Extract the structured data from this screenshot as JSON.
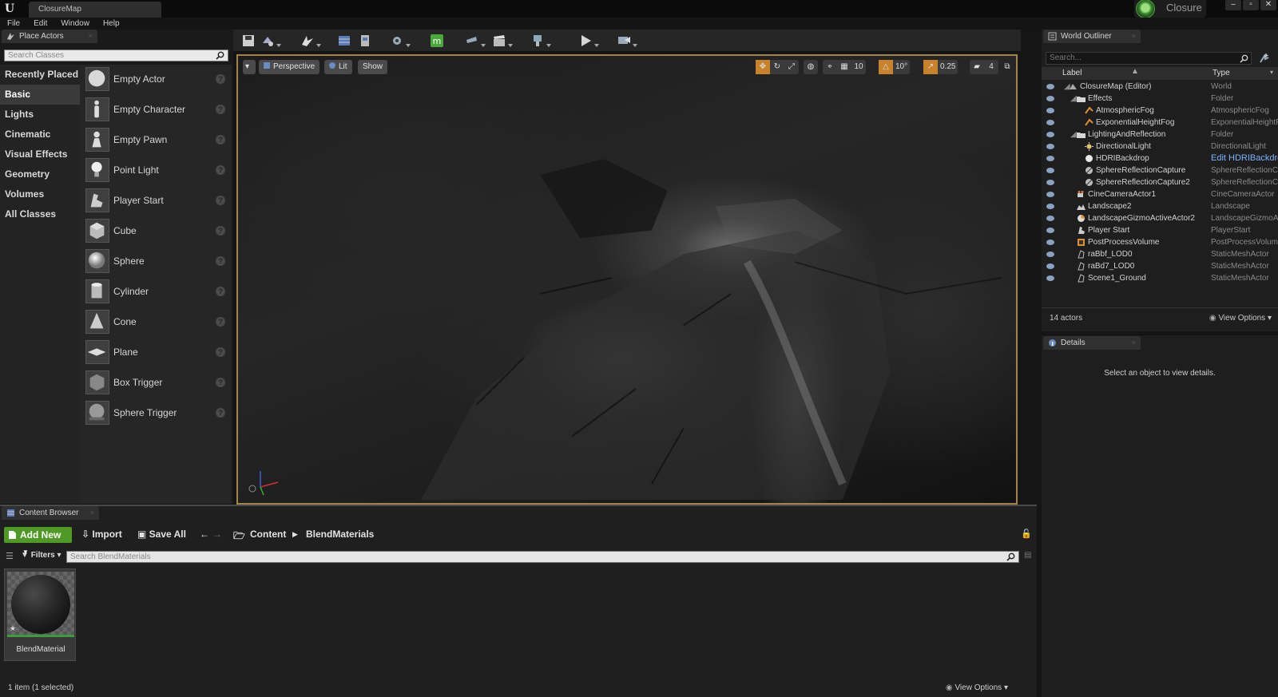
{
  "window": {
    "doc_tab": "ClosureMap",
    "project_name": "Closure",
    "controls": [
      "–",
      "▫",
      "✕"
    ]
  },
  "menu": [
    "File",
    "Edit",
    "Window",
    "Help"
  ],
  "place_actors": {
    "tab_label": "Place Actors",
    "search_placeholder": "Search Classes",
    "categories": [
      "Recently Placed",
      "Basic",
      "Lights",
      "Cinematic",
      "Visual Effects",
      "Geometry",
      "Volumes",
      "All Classes"
    ],
    "active_category": "Basic",
    "items": [
      "Empty Actor",
      "Empty Character",
      "Empty Pawn",
      "Point Light",
      "Player Start",
      "Cube",
      "Sphere",
      "Cylinder",
      "Cone",
      "Plane",
      "Box Trigger",
      "Sphere Trigger"
    ]
  },
  "viewport": {
    "perspective_label": "Perspective",
    "lit_label": "Lit",
    "show_label": "Show",
    "grid_snap": "10",
    "rotation_snap": "10°",
    "scale_snap": "0.25",
    "camera_speed": "4"
  },
  "outliner": {
    "tab_label": "World Outliner",
    "search_placeholder": "Search...",
    "col_label": "Label",
    "col_type": "Type",
    "rows": [
      {
        "label": "ClosureMap (Editor)",
        "type": "World"
      },
      {
        "label": "Effects",
        "type": "Folder"
      },
      {
        "label": "AtmosphericFog",
        "type": "AtmosphericFog"
      },
      {
        "label": "ExponentialHeightFog",
        "type": "ExponentialHeightFog"
      },
      {
        "label": "LightingAndReflection",
        "type": "Folder"
      },
      {
        "label": "DirectionalLight",
        "type": "DirectionalLight"
      },
      {
        "label": "HDRIBackdrop",
        "type": "Edit HDRIBackdrop"
      },
      {
        "label": "SphereReflectionCapture",
        "type": "SphereReflectionCapture"
      },
      {
        "label": "SphereReflectionCapture2",
        "type": "SphereReflectionCapture"
      },
      {
        "label": "CineCameraActor1",
        "type": "CineCameraActor"
      },
      {
        "label": "Landscape2",
        "type": "Landscape"
      },
      {
        "label": "LandscapeGizmoActiveActor2",
        "type": "LandscapeGizmoActiveActor"
      },
      {
        "label": "Player Start",
        "type": "PlayerStart"
      },
      {
        "label": "PostProcessVolume",
        "type": "PostProcessVolume"
      },
      {
        "label": "raBbf_LOD0",
        "type": "StaticMeshActor"
      },
      {
        "label": "raBd7_LOD0",
        "type": "StaticMeshActor"
      },
      {
        "label": "Scene1_Ground",
        "type": "StaticMeshActor"
      }
    ],
    "actor_count": "14 actors",
    "view_options": "View Options"
  },
  "details": {
    "tab_label": "Details",
    "empty_message": "Select an object to view details."
  },
  "content_browser": {
    "tab_label": "Content Browser",
    "add_new": "Add New",
    "import": "Import",
    "save_all": "Save All",
    "path_root": "Content",
    "path_folder": "BlendMaterials",
    "filters": "Filters",
    "search_placeholder": "Search BlendMaterials",
    "asset_name": "BlendMaterial",
    "status": "1 item (1 selected)",
    "view_options": "View Options"
  },
  "colors": {
    "accent_green": "#4e9a24",
    "viewport_border": "#a2834a",
    "snap_orange": "#c8822a",
    "link_blue": "#7ab4ff"
  }
}
